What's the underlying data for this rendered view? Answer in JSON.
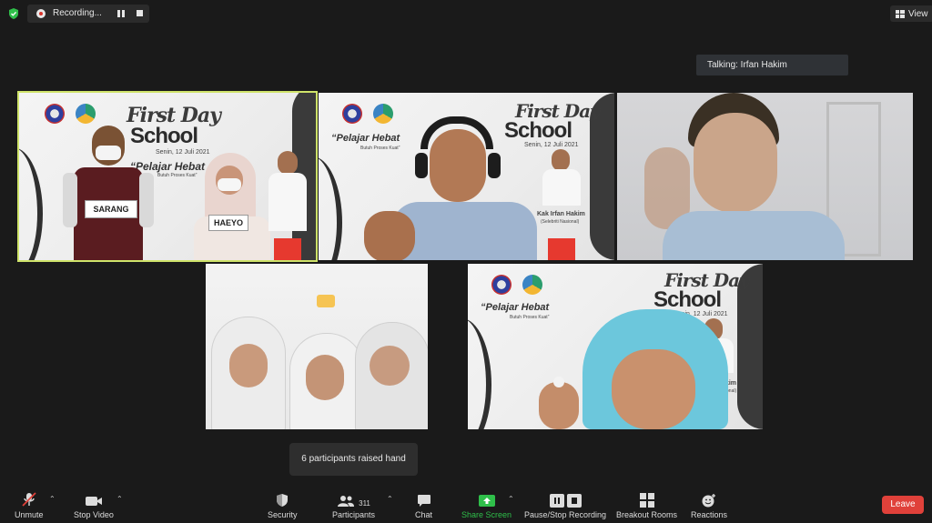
{
  "topbar": {
    "recording_label": "Recording...",
    "view_label": "View"
  },
  "talking_label": "Talking: Irfan Hakim",
  "banner": {
    "first_day": "First Day",
    "school": "School",
    "date": "Senin, 12 Juli 2021",
    "tagline": "“Pelajar Hebat",
    "tagline_sub": "Butuh Proses Kuat”",
    "host_name": "Kak Irfan Hakim",
    "host_role": "(Selebriti Nasional)",
    "host_name_short": "Hakim",
    "host_role_short": "Nasional)"
  },
  "signs": {
    "left": "SARANG",
    "right": "HAEYO"
  },
  "toolbar": {
    "unmute": "Unmute",
    "stop_video": "Stop Video",
    "security": "Security",
    "participants": "Participants",
    "participants_count": "311",
    "chat": "Chat",
    "share_screen": "Share Screen",
    "pause_stop_recording": "Pause/Stop Recording",
    "breakout_rooms": "Breakout Rooms",
    "reactions": "Reactions",
    "leave": "Leave"
  },
  "tooltip": "6 participants raised hand",
  "colors": {
    "background": "#1a1a1a",
    "active_speaker_border": "#cfe36a",
    "share_green": "#2fbf4a",
    "leave_red": "#e0413a",
    "muted_red": "#e0413a"
  },
  "icons": [
    "shield-icon",
    "record-icon",
    "pause-icon",
    "stop-icon",
    "grid-view-icon",
    "mic-muted-icon",
    "video-icon",
    "security-icon",
    "participants-icon",
    "chat-icon",
    "share-screen-icon",
    "pause-recording-icon",
    "breakout-rooms-icon",
    "reactions-icon",
    "chevron-up-icon"
  ]
}
